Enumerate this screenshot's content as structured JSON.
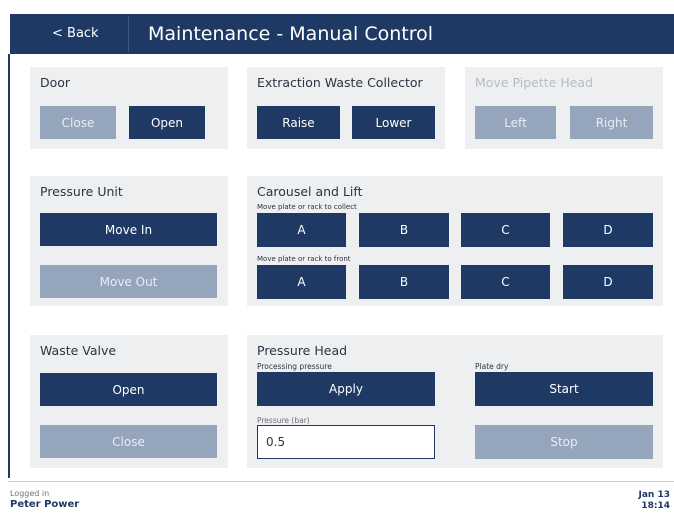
{
  "header": {
    "back_label": "< Back",
    "title": "Maintenance - Manual Control"
  },
  "door": {
    "title": "Door",
    "close": "Close",
    "open": "Open"
  },
  "extraction": {
    "title": "Extraction Waste Collector",
    "raise": "Raise",
    "lower": "Lower"
  },
  "pipette": {
    "title": "Move Pipette Head",
    "left": "Left",
    "right": "Right"
  },
  "pressure_unit": {
    "title": "Pressure Unit",
    "move_in": "Move In",
    "move_out": "Move Out"
  },
  "carousel": {
    "title": "Carousel and Lift",
    "collect_label": "Move plate or rack to collect",
    "front_label": "Move plate or rack to front",
    "collect_buttons": [
      "A",
      "B",
      "C",
      "D"
    ],
    "front_buttons": [
      "A",
      "B",
      "C",
      "D"
    ]
  },
  "waste_valve": {
    "title": "Waste Valve",
    "open": "Open",
    "close": "Close"
  },
  "pressure_head": {
    "title": "Pressure Head",
    "processing_label": "Processing pressure",
    "apply": "Apply",
    "pressure_field_label": "Pressure (bar)",
    "pressure_value": "0.5",
    "plate_dry_label": "Plate dry",
    "start": "Start",
    "stop": "Stop"
  },
  "footer": {
    "logged_in_label": "Logged in",
    "user": "Peter Power",
    "date": "Jan 13",
    "time": "18:14"
  },
  "colors": {
    "primary": "#1e3963",
    "inactive": "#95a6bc",
    "panel_bg": "#eeeff1"
  }
}
